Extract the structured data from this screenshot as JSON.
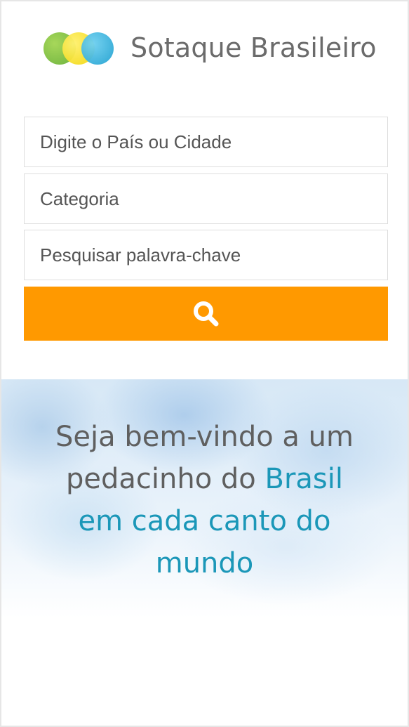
{
  "brand": {
    "name": "Sotaque Brasileiro",
    "logo_icon": "three-overlapping-circles-icon",
    "logo_colors": [
      "#6db33f",
      "#f2d60a",
      "#1fa0d0"
    ]
  },
  "search": {
    "country_placeholder": "Digite o País ou Cidade",
    "category_placeholder": "Categoria",
    "keyword_placeholder": "Pesquisar palavra-chave",
    "button_icon": "search-icon",
    "button_color": "#ff9900"
  },
  "hero": {
    "line1": "Seja bem-vindo a um",
    "line2_plain": "pedacinho do ",
    "line2_accent": "Brasil",
    "line3": "em cada canto do",
    "line4": "mundo",
    "accent_color": "#1b97b8"
  }
}
